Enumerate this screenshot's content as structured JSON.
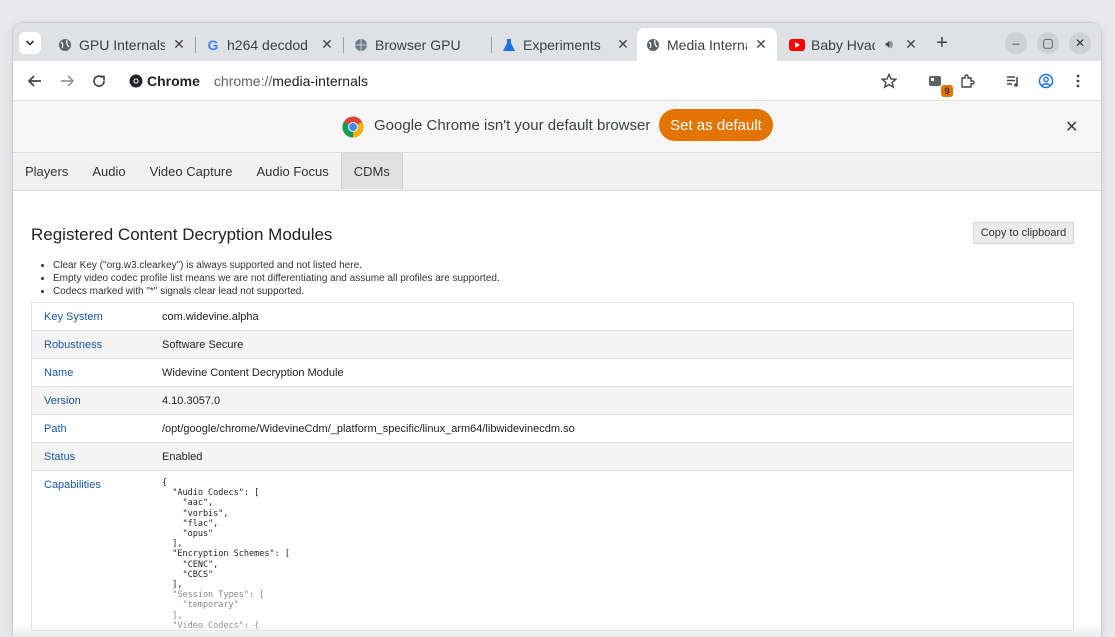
{
  "tabs": [
    {
      "title": "GPU Internals",
      "active": false
    },
    {
      "title": "h264 decdod",
      "active": false
    },
    {
      "title": "Browser GPU",
      "active": false
    },
    {
      "title": "Experiments",
      "active": false
    },
    {
      "title": "Media Interna",
      "active": true
    },
    {
      "title": "Baby Hvad",
      "active": false
    }
  ],
  "toolbar": {
    "site_chip": "Chrome",
    "url_scheme": "chrome://",
    "url_host": "media-internals",
    "extension_badge": "9"
  },
  "infobar": {
    "message": "Google Chrome isn't your default browser",
    "button_label": "Set as default"
  },
  "page_tabs": [
    "Players",
    "Audio",
    "Video Capture",
    "Audio Focus",
    "CDMs"
  ],
  "page_tabs_selected": "CDMs",
  "heading": "Registered Content Decryption Modules",
  "copy_button": "Copy to clipboard",
  "notes": [
    "Clear Key (\"org.w3.clearkey\") is always supported and not listed here.",
    "Empty video codec profile list means we are not differentiating and assume all profiles are supported.",
    "Codecs marked with \"*\" signals clear lead not supported."
  ],
  "rows": [
    {
      "key": "Key System",
      "value": "com.widevine.alpha"
    },
    {
      "key": "Robustness",
      "value": "Software Secure"
    },
    {
      "key": "Name",
      "value": "Widevine Content Decryption Module"
    },
    {
      "key": "Version",
      "value": "4.10.3057.0"
    },
    {
      "key": "Path",
      "value": "/opt/google/chrome/WidevineCdm/_platform_specific/linux_arm64/libwidevinecdm.so"
    },
    {
      "key": "Status",
      "value": "Enabled"
    }
  ],
  "capabilities_key": "Capabilities",
  "capabilities_json": "{\n  \"Audio Codecs\": [\n    \"aac\",\n    \"vorbis\",\n    \"flac\",\n    \"opus\"\n  ],\n  \"Encryption Schemes\": [\n    \"CENC\",\n    \"CBCS\"\n  ],",
  "capabilities_json_faded": "  \"Session Types\": [\n    \"temporary\"\n  ],\n  \"Video Codecs\": {",
  "colors": {
    "accent_orange": "#e37400",
    "tab_strip": "#dfe1e5",
    "link_blue": "#1a56a8"
  }
}
